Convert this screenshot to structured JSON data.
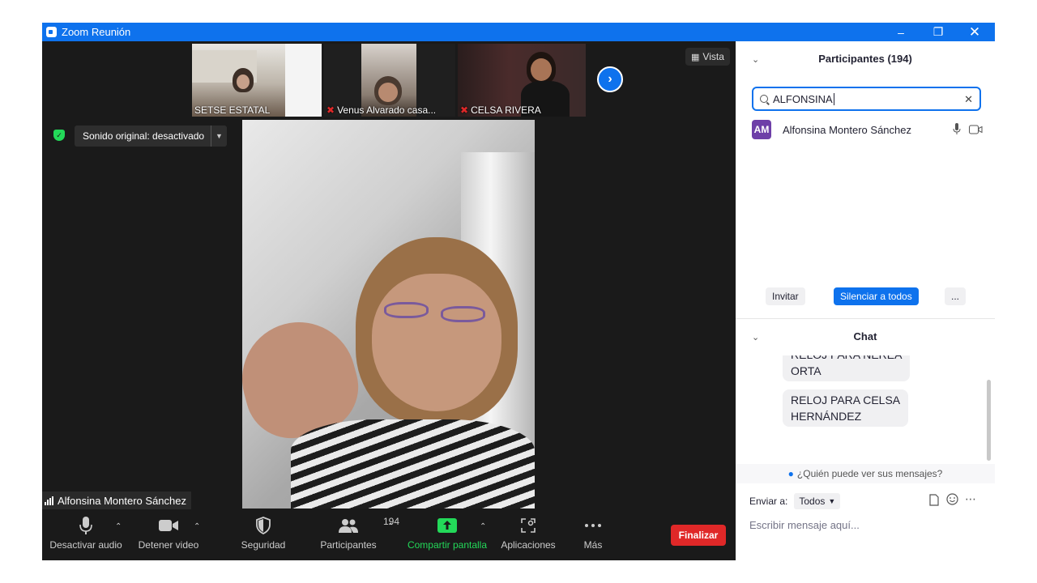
{
  "window": {
    "title": "Zoom Reunión"
  },
  "thumbnails": [
    {
      "name": "SETSE ESTATAL",
      "muted": false
    },
    {
      "name": "Venus Alvarado casa...",
      "muted": true
    },
    {
      "name": "CELSA RIVERA",
      "muted": true
    }
  ],
  "view": {
    "label": "Vista"
  },
  "sound": {
    "label": "Sonido original: desactivado"
  },
  "speaker": {
    "name": "Alfonsina Montero Sánchez"
  },
  "toolbar": {
    "mute": "Desactivar audio",
    "video": "Detener video",
    "security": "Seguridad",
    "participants": "Participantes",
    "participants_count": "194",
    "share": "Compartir pantalla",
    "apps": "Aplicaciones",
    "more": "Más",
    "end": "Finalizar"
  },
  "participants_panel": {
    "title": "Participantes (194)",
    "search_value": "ALFONSINA",
    "participant": {
      "initials": "AM",
      "name": "Alfonsina Montero Sánchez"
    },
    "invite": "Invitar",
    "mute_all": "Silenciar a todos",
    "more": "..."
  },
  "chat": {
    "title": "Chat",
    "messages": [
      {
        "line1": "RELOJ PARA NEREA",
        "line2": "ORTA"
      },
      {
        "line1": "RELOJ PARA CELSA",
        "line2": "HERNÁNDEZ"
      }
    ],
    "who_can_see": "¿Quién puede ver sus mensajes?",
    "send_to_label": "Enviar a:",
    "send_to_value": "Todos",
    "input_placeholder": "Escribir mensaje aquí..."
  },
  "colors": {
    "zoom_blue": "#0e72ed",
    "end_red": "#e02828",
    "share_green": "#23d959",
    "avatar_purple": "#6e3fa8"
  }
}
